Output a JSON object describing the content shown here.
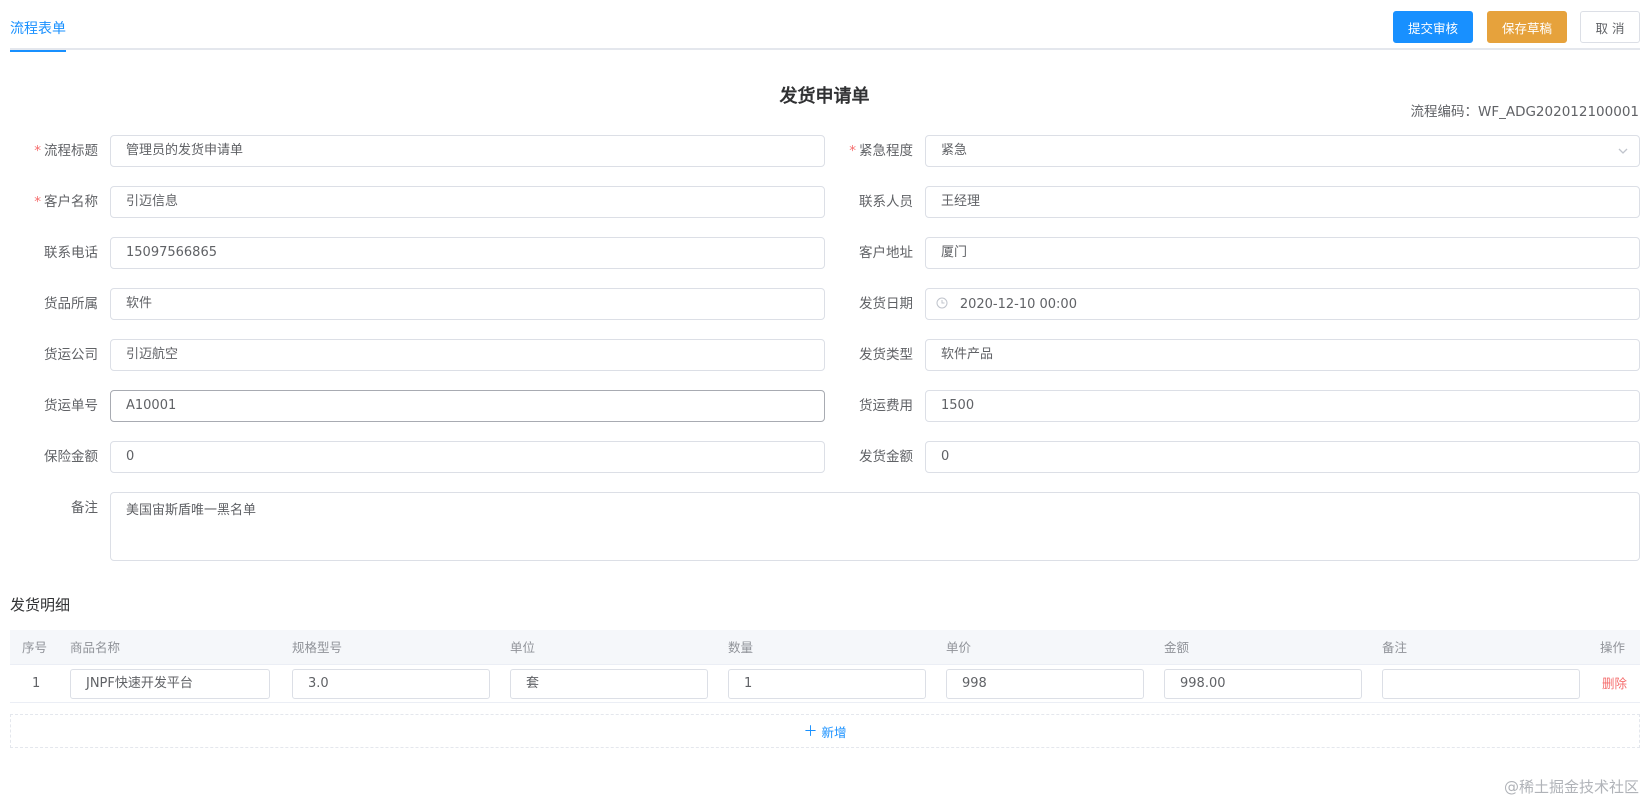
{
  "tabs": {
    "active": "流程表单"
  },
  "actions": {
    "submit": "提交审核",
    "save_draft": "保存草稿",
    "cancel": "取 消"
  },
  "form": {
    "title": "发货申请单",
    "flow_code": "流程编码：WF_ADG202012100001",
    "fields": {
      "flow_title": {
        "label": "流程标题",
        "required": true,
        "value": "管理员的发货申请单"
      },
      "urgency": {
        "label": "紧急程度",
        "required": true,
        "value": "紧急"
      },
      "customer_name": {
        "label": "客户名称",
        "required": true,
        "value": "引迈信息"
      },
      "contact_person": {
        "label": "联系人员",
        "value": "王经理"
      },
      "contact_phone": {
        "label": "联系电话",
        "value": "15097566865"
      },
      "customer_address": {
        "label": "客户地址",
        "value": "厦门"
      },
      "goods_category": {
        "label": "货品所属",
        "value": "软件"
      },
      "ship_date": {
        "label": "发货日期",
        "value": "2020-12-10 00:00"
      },
      "freight_company": {
        "label": "货运公司",
        "value": "引迈航空"
      },
      "ship_type": {
        "label": "发货类型",
        "value": "软件产品"
      },
      "freight_number": {
        "label": "货运单号",
        "value": "A10001"
      },
      "freight_cost": {
        "label": "货运费用",
        "value": "1500"
      },
      "insurance_amount": {
        "label": "保险金额",
        "value": "0"
      },
      "ship_amount": {
        "label": "发货金额",
        "value": "0"
      },
      "remark": {
        "label": "备注",
        "value": "美国宙斯盾唯一黑名单"
      }
    }
  },
  "details": {
    "title": "发货明细",
    "columns": [
      "序号",
      "商品名称",
      "规格型号",
      "单位",
      "数量",
      "单价",
      "金额",
      "备注",
      "操作"
    ],
    "rows": [
      {
        "index": "1",
        "name": "JNPF快速开发平台",
        "spec": "3.0",
        "unit": "套",
        "qty": "1",
        "price": "998",
        "amount": "998.00",
        "remark": "",
        "action": "删除"
      }
    ],
    "add_label": "新增"
  },
  "watermark": "@稀土掘金技术社区",
  "icons": {
    "clock": "clock-icon",
    "chevron": "chevron-down-icon",
    "plus": "plus-icon"
  },
  "colors": {
    "primary": "#1890ff",
    "warning": "#e6a23c",
    "danger": "#f56c6c"
  }
}
